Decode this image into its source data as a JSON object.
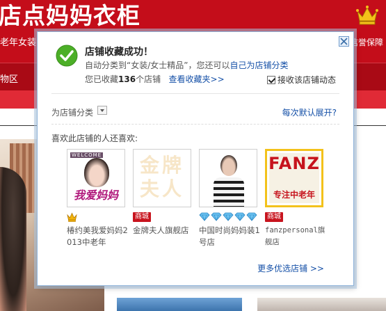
{
  "background": {
    "store_title": "店点妈妈衣柜",
    "sub_left": "老年女装",
    "sub_right": "信誉保障",
    "nav_item": "物区"
  },
  "dialog": {
    "title": "店铺收藏成功！",
    "line2_prefix": "自动分类到“女装/女士精品”，您还可以",
    "line2_link": "自己为店铺分类",
    "line3_prefix": "您已收藏",
    "line3_count": "136",
    "line3_suffix": "个店铺",
    "view_favorites": "查看收藏夹>>",
    "receive_updates": "接收该店铺动态",
    "category_label": "为店铺分类",
    "expand_default": "每次默认展开?",
    "like_heading": "喜欢此店铺的人还喜欢:",
    "more_shops": "更多优选店铺 >>"
  },
  "shops": [
    {
      "thumb_welcome": "WELCOME",
      "thumb_text": "我爱妈妈",
      "badge": "crown",
      "name": "椿约美我爱妈妈2013中老年"
    },
    {
      "thumb_text": "金牌夫人",
      "badge": "商城",
      "name": "金牌夫人旗舰店"
    },
    {
      "badge": "diamonds",
      "name": "中国时尚妈妈装1号店"
    },
    {
      "thumb_text1": "FANZ",
      "thumb_text2": "专注中老年",
      "badge": "商城",
      "name": "fanzpersonal旗舰店"
    }
  ],
  "colors": {
    "header_red": "#c40d1a",
    "link_blue": "#1550a7",
    "success_green": "#4caf27",
    "mall_badge_red": "#c8141e"
  }
}
